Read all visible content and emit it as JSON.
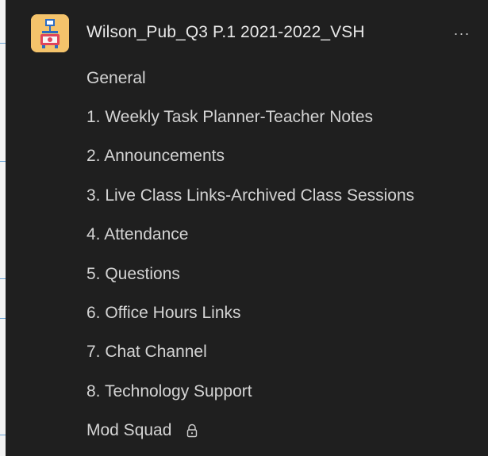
{
  "team": {
    "name": "Wilson_Pub_Q3 P.1 2021-2022_VSH",
    "more_label": "···",
    "avatar_icon": "easel-icon",
    "avatar_color": "#f4c36b"
  },
  "channels": [
    {
      "label": "General"
    },
    {
      "label": "1. Weekly Task Planner-Teacher Notes"
    },
    {
      "label": "2. Announcements"
    },
    {
      "label": "3. Live Class Links-Archived Class Sessions"
    },
    {
      "label": "4. Attendance"
    },
    {
      "label": "5. Questions"
    },
    {
      "label": "6. Office Hours Links"
    },
    {
      "label": "7. Chat Channel"
    },
    {
      "label": "8. Technology Support"
    },
    {
      "label": "Mod Squad",
      "private": true,
      "icon": "lock-icon"
    }
  ],
  "colors": {
    "background": "#1f1f1f",
    "text": "#d4d4d4"
  }
}
